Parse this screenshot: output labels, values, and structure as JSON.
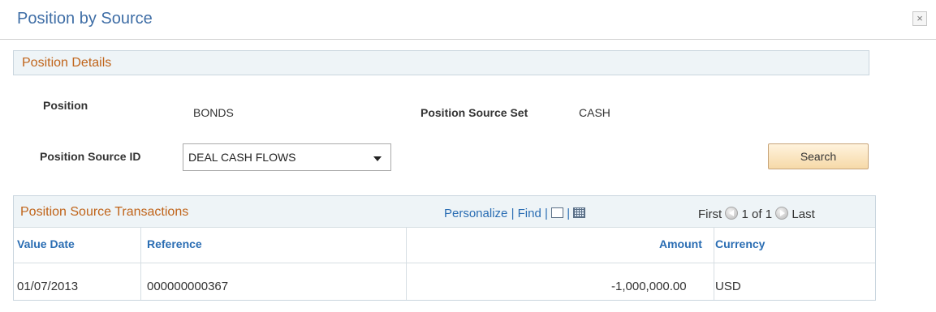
{
  "dialog": {
    "title": "Position by Source",
    "close_label": "×"
  },
  "details": {
    "group_title": "Position Details",
    "position_label": "Position",
    "position_value": "BONDS",
    "source_set_label": "Position Source Set",
    "source_set_value": "CASH",
    "source_id_label": "Position Source ID",
    "source_id_value": "DEAL CASH FLOWS",
    "search_label": "Search"
  },
  "grid": {
    "title": "Position Source Transactions",
    "personalize": "Personalize",
    "find": "Find",
    "separator": "|",
    "first": "First",
    "range": "1 of 1",
    "last": "Last",
    "columns": {
      "value_date": "Value Date",
      "reference": "Reference",
      "amount": "Amount",
      "currency": "Currency"
    },
    "rows": [
      {
        "value_date": "01/07/2013",
        "reference": "000000000367",
        "amount": "-1,000,000.00",
        "currency": "USD"
      }
    ]
  },
  "icons": {
    "close": "close-icon",
    "new_window": "new-window-icon",
    "download": "download-spreadsheet-icon",
    "previous": "previous-arrow-icon",
    "next": "next-arrow-icon",
    "dropdown": "chevron-down-icon"
  }
}
